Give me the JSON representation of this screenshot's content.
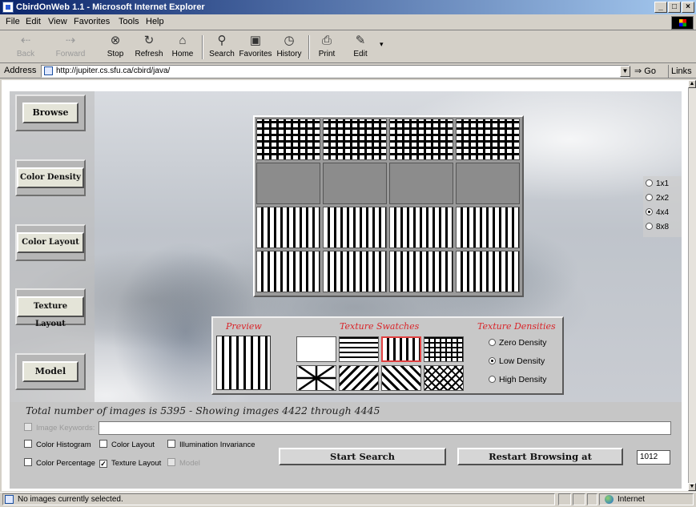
{
  "window": {
    "title": "CbirdOnWeb 1.1 - Microsoft Internet Explorer",
    "minimize": "_",
    "restore": "□",
    "close": "×"
  },
  "menu": [
    "File",
    "Edit",
    "View",
    "Favorites",
    "Tools",
    "Help"
  ],
  "toolbar": {
    "back": "Back",
    "forward": "Forward",
    "stop": "Stop",
    "refresh": "Refresh",
    "home": "Home",
    "search": "Search",
    "favorites": "Favorites",
    "history": "History",
    "print": "Print",
    "edit": "Edit"
  },
  "address": {
    "label": "Address",
    "url": "http://jupiter.cs.sfu.ca/cbird/java/",
    "go": "Go",
    "links": "Links »"
  },
  "nav": [
    "Browse",
    "Color Density",
    "Color Layout",
    "Texture Layout",
    "Model"
  ],
  "resolution": {
    "options": [
      "1x1",
      "2x2",
      "4x4",
      "8x8"
    ],
    "selected": "4x4"
  },
  "palette": {
    "preview_title": "Preview",
    "swatches_title": "Texture Swatches",
    "densities_title": "Texture Densities",
    "densities": [
      "Zero Density",
      "Low Density",
      "High Density"
    ],
    "selected_density": "Low Density"
  },
  "bottom": {
    "total_text": "Total number of images is 5395  -  Showing images 4422 through 4445",
    "image_keywords": "Image Keywords:",
    "keyword_value": "",
    "features": {
      "color_histogram": "Color Histogram",
      "color_layout": "Color Layout",
      "illumination_invariance": "Illumination Invariance",
      "color_percentage": "Color Percentage",
      "texture_layout": "Texture Layout",
      "model": "Model"
    },
    "start_search": "Start Search",
    "restart_browsing": "Restart Browsing at",
    "restart_value": "1012"
  },
  "status": {
    "text": "No images currently selected.",
    "zone": "Internet"
  }
}
